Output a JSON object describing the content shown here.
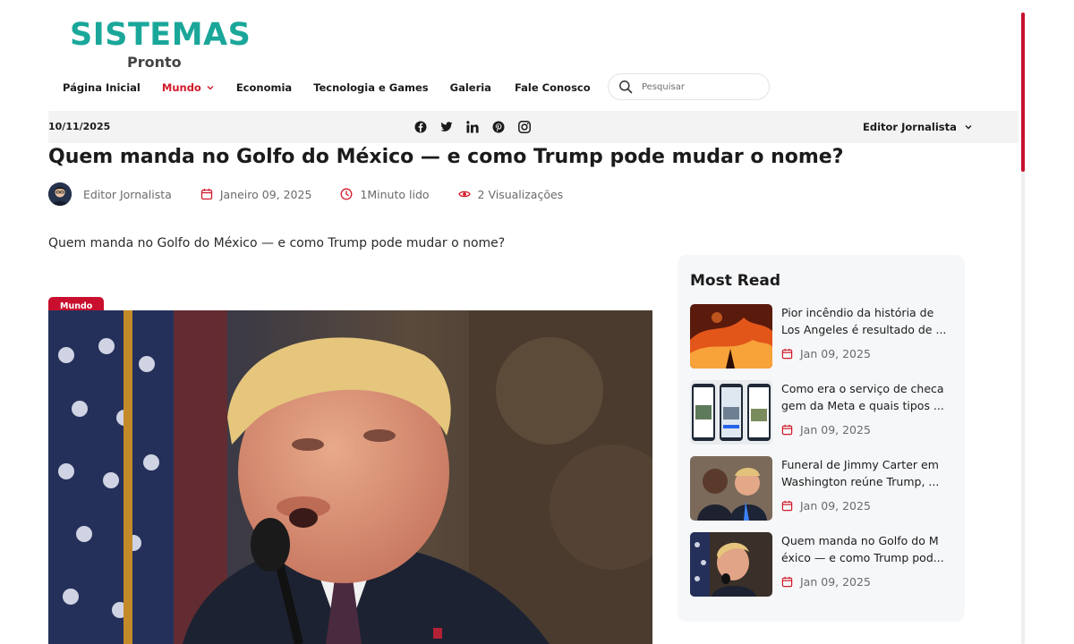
{
  "logo": {
    "main": "SISTEMAS",
    "sub": "Pronto"
  },
  "nav": {
    "items": [
      {
        "label": "Página Inicial"
      },
      {
        "label": "Mundo"
      },
      {
        "label": "Economia"
      },
      {
        "label": "Tecnologia e Games"
      },
      {
        "label": "Galeria"
      },
      {
        "label": "Fale Conosco"
      }
    ],
    "active": "Mundo"
  },
  "search": {
    "placeholder": "Pesquisar"
  },
  "strip": {
    "date": "10/11/2025",
    "socials": [
      "facebook-icon",
      "twitter-icon",
      "linkedin-icon",
      "pinterest-icon",
      "instagram-icon"
    ],
    "editor": "Editor Jornalista"
  },
  "article": {
    "title": "Quem manda no Golfo do México — e como Trump pode mudar o nome?",
    "author": "Editor Jornalista",
    "date": "Janeiro 09, 2025",
    "read_time": "1Minuto lido",
    "views": "2 Visualizações",
    "lead": "Quem manda no Golfo do México — e como Trump pode mudar o nome?",
    "category": "Mundo"
  },
  "sidebar": {
    "title": "Most Read",
    "items": [
      {
        "title": "Pior incêndio da história de Los Angeles é resultado de ...",
        "date": "Jan 09, 2025"
      },
      {
        "title": "Como era o serviço de checa gem da Meta e quais tipos ...",
        "date": "Jan 09, 2025"
      },
      {
        "title": "Funeral de Jimmy Carter em Washington reúne Trump, ...",
        "date": "Jan 09, 2025"
      },
      {
        "title": "Quem manda no Golfo do M éxico — e como Trump pod...",
        "date": "Jan 09, 2025"
      }
    ]
  },
  "colors": {
    "accent": "#c8102e",
    "brand": "#1aa79a"
  }
}
